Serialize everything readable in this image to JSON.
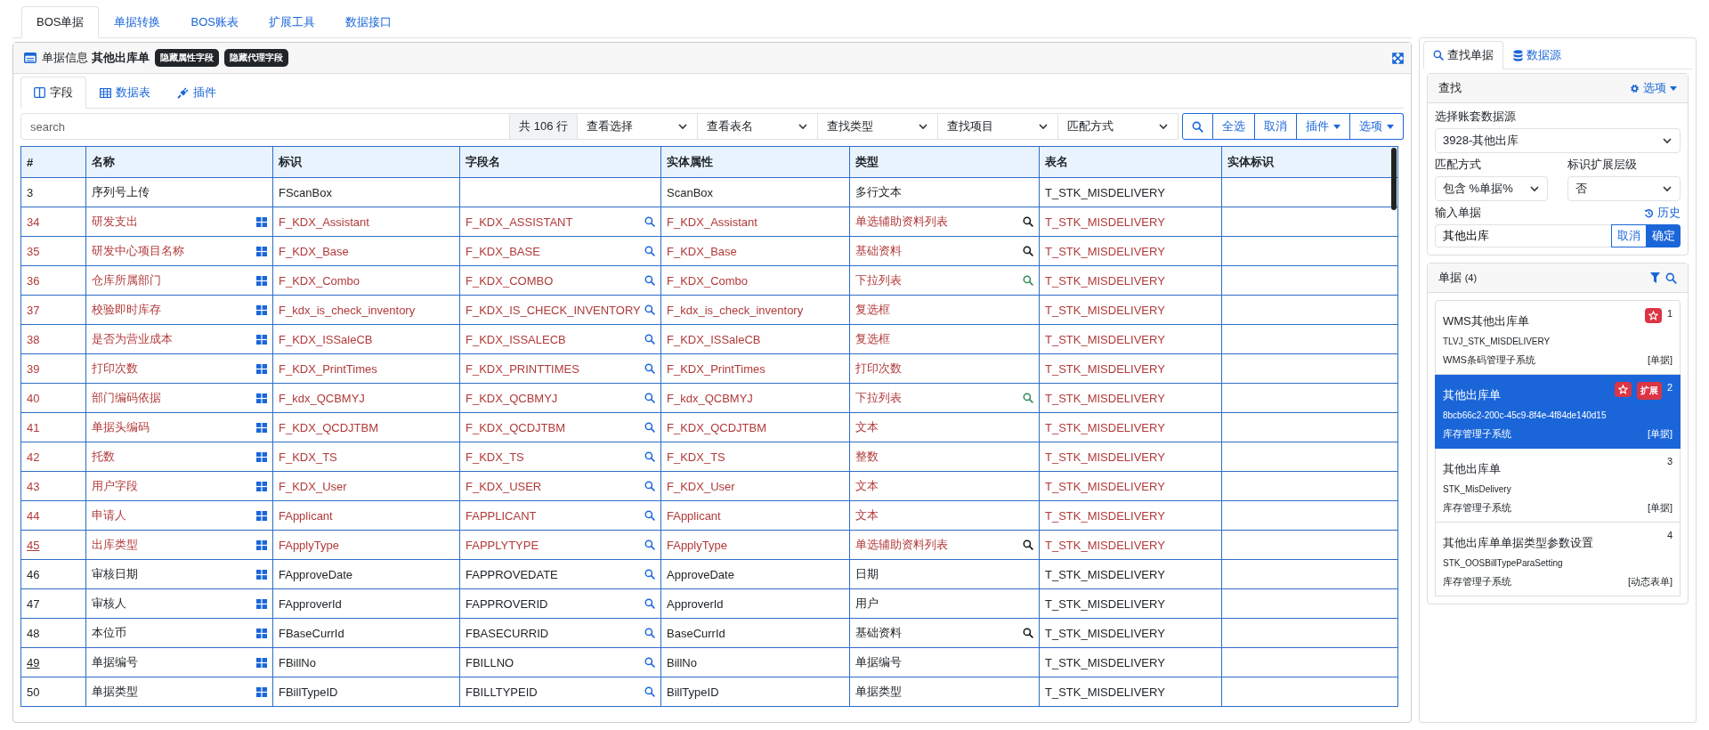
{
  "top_tabs": [
    {
      "label": "BOS单据",
      "selected": true
    },
    {
      "label": "单据转换",
      "selected": false
    },
    {
      "label": "BOS账表",
      "selected": false
    },
    {
      "label": "扩展工具",
      "selected": false
    },
    {
      "label": "数据接口",
      "selected": false
    }
  ],
  "panel": {
    "label": "单据信息",
    "bill": "其他出库单",
    "badges": [
      "隐藏属性字段",
      "隐藏代理字段"
    ]
  },
  "inner_tabs": [
    {
      "label": "字段",
      "selected": true
    },
    {
      "label": "数据表",
      "selected": false
    },
    {
      "label": "插件",
      "selected": false
    }
  ],
  "toolbar": {
    "search_placeholder": "search",
    "count": "共 106 行",
    "selects": [
      "查看选择",
      "查看表名",
      "查找类型",
      "查找项目",
      "匹配方式"
    ],
    "buttons": [
      {
        "kind": "search"
      },
      {
        "kind": "text",
        "label": "全选"
      },
      {
        "kind": "text",
        "label": "取消"
      },
      {
        "kind": "menu",
        "label": "插件"
      },
      {
        "kind": "menu",
        "label": "选项"
      }
    ]
  },
  "table": {
    "columns": [
      "#",
      "名称",
      "标识",
      "字段名",
      "实体属性",
      "类型",
      "表名",
      "实体标识"
    ],
    "rows": [
      {
        "num": "3",
        "name": "序列号上传",
        "key": "FScanBox",
        "field": "",
        "entity": "ScanBox",
        "type": "多行文本",
        "table": "T_STK_MISDELIVERY",
        "extension": false,
        "underlined": false,
        "name_icon": false,
        "field_icon": false
      },
      {
        "num": "34",
        "name": "研发支出",
        "key": "F_KDX_Assistant",
        "field": "F_KDX_ASSISTANT",
        "entity": "F_KDX_Assistant",
        "type": "单选辅助资料列表",
        "table": "T_STK_MISDELIVERY",
        "extension": true,
        "underlined": false,
        "name_icon": true,
        "field_icon": true,
        "color": "#111111"
      },
      {
        "num": "35",
        "name": "研发中心项目名称",
        "key": "F_KDX_Base",
        "field": "F_KDX_BASE",
        "entity": "F_KDX_Base",
        "type": "基础资料",
        "table": "T_STK_MISDELIVERY",
        "extension": true,
        "underlined": false,
        "name_icon": true,
        "field_icon": true,
        "color": "#111111"
      },
      {
        "num": "36",
        "name": "仓库所属部门",
        "key": "F_KDX_Combo",
        "field": "F_KDX_COMBO",
        "entity": "F_KDX_Combo",
        "type": "下拉列表",
        "table": "T_STK_MISDELIVERY",
        "extension": true,
        "underlined": false,
        "name_icon": true,
        "field_icon": true,
        "color": "#2e8b57"
      },
      {
        "num": "37",
        "name": "校验即时库存",
        "key": "F_kdx_is_check_inventory",
        "field": "F_KDX_IS_CHECK_INVENTORY",
        "entity": "F_kdx_is_check_inventory",
        "type": "复选框",
        "table": "T_STK_MISDELIVERY",
        "extension": true,
        "underlined": false,
        "name_icon": true,
        "field_icon": true
      },
      {
        "num": "38",
        "name": "是否为营业成本",
        "key": "F_KDX_ISSaleCB",
        "field": "F_KDX_ISSALECB",
        "entity": "F_KDX_ISSaleCB",
        "type": "复选框",
        "table": "T_STK_MISDELIVERY",
        "extension": true,
        "underlined": false,
        "name_icon": true,
        "field_icon": true
      },
      {
        "num": "39",
        "name": "打印次数",
        "key": "F_KDX_PrintTimes",
        "field": "F_KDX_PRINTTIMES",
        "entity": "F_KDX_PrintTimes",
        "type": "打印次数",
        "table": "T_STK_MISDELIVERY",
        "extension": true,
        "underlined": false,
        "name_icon": true,
        "field_icon": true
      },
      {
        "num": "40",
        "name": "部门编码依据",
        "key": "F_kdx_QCBMYJ",
        "field": "F_KDX_QCBMYJ",
        "entity": "F_kdx_QCBMYJ",
        "type": "下拉列表",
        "table": "T_STK_MISDELIVERY",
        "extension": true,
        "underlined": false,
        "name_icon": true,
        "field_icon": true,
        "color": "#2e8b57"
      },
      {
        "num": "41",
        "name": "单据头编码",
        "key": "F_KDX_QCDJTBM",
        "field": "F_KDX_QCDJTBM",
        "entity": "F_KDX_QCDJTBM",
        "type": "文本",
        "table": "T_STK_MISDELIVERY",
        "extension": true,
        "underlined": false,
        "name_icon": true,
        "field_icon": true
      },
      {
        "num": "42",
        "name": "托数",
        "key": "F_KDX_TS",
        "field": "F_KDX_TS",
        "entity": "F_KDX_TS",
        "type": "整数",
        "table": "T_STK_MISDELIVERY",
        "extension": true,
        "underlined": false,
        "name_icon": true,
        "field_icon": true
      },
      {
        "num": "43",
        "name": "用户字段",
        "key": "F_KDX_User",
        "field": "F_KDX_USER",
        "entity": "F_KDX_User",
        "type": "文本",
        "table": "T_STK_MISDELIVERY",
        "extension": true,
        "underlined": false,
        "name_icon": true,
        "field_icon": true
      },
      {
        "num": "44",
        "name": "申请人",
        "key": "FApplicant",
        "field": "FAPPLICANT",
        "entity": "FApplicant",
        "type": "文本",
        "table": "T_STK_MISDELIVERY",
        "extension": true,
        "underlined": false,
        "name_icon": true,
        "field_icon": true
      },
      {
        "num": "45",
        "name": "出库类型",
        "key": "FApplyType",
        "field": "FAPPLYTYPE",
        "entity": "FApplyType",
        "type": "单选辅助资料列表",
        "table": "T_STK_MISDELIVERY",
        "extension": true,
        "underlined": true,
        "name_icon": true,
        "field_icon": true,
        "color": "#111111"
      },
      {
        "num": "46",
        "name": "审核日期",
        "key": "FApproveDate",
        "field": "FAPPROVEDATE",
        "entity": "ApproveDate",
        "type": "日期",
        "table": "T_STK_MISDELIVERY",
        "extension": false,
        "underlined": false,
        "name_icon": true,
        "field_icon": true
      },
      {
        "num": "47",
        "name": "审核人",
        "key": "FApproverId",
        "field": "FAPPROVERID",
        "entity": "ApproverId",
        "type": "用户",
        "table": "T_STK_MISDELIVERY",
        "extension": false,
        "underlined": false,
        "name_icon": true,
        "field_icon": true
      },
      {
        "num": "48",
        "name": "本位币",
        "key": "FBaseCurrId",
        "field": "FBASECURRID",
        "entity": "BaseCurrId",
        "type": "基础资料",
        "table": "T_STK_MISDELIVERY",
        "extension": false,
        "underlined": false,
        "name_icon": true,
        "field_icon": true,
        "color": "#111111"
      },
      {
        "num": "49",
        "name": "单据编号",
        "key": "FBillNo",
        "field": "FBILLNO",
        "entity": "BillNo",
        "type": "单据编号",
        "table": "T_STK_MISDELIVERY",
        "extension": false,
        "underlined": true,
        "name_icon": true,
        "field_icon": true
      },
      {
        "num": "50",
        "name": "单据类型",
        "key": "FBillTypeID",
        "field": "FBILLTYPEID",
        "entity": "BillTypeID",
        "type": "单据类型",
        "table": "T_STK_MISDELIVERY",
        "extension": false,
        "underlined": false,
        "name_icon": true,
        "field_icon": true
      }
    ]
  },
  "side_tabs": [
    {
      "label": "查找单据",
      "selected": true
    },
    {
      "label": "数据源",
      "selected": false
    }
  ],
  "find": {
    "title": "查找",
    "options": "选项",
    "source_label": "选择账套数据源",
    "source": "3928-其他出库",
    "match_label": "匹配方式",
    "match": "包含 %单据%",
    "level_label": "标识扩展层级",
    "level": "否",
    "input_label": "输入单据",
    "history": "历史",
    "input_value": "其他出库",
    "cancel": "取消",
    "ok": "确定"
  },
  "bills": {
    "title": "单据",
    "count": "(4)",
    "items": [
      {
        "index": "1",
        "title": "WMS其他出库单",
        "id": "TLVJ_STK_MISDELIVERY",
        "subsystem": "WMS条码管理子系统",
        "kind": "[单据]",
        "starred": true,
        "selected": false
      },
      {
        "index": "2",
        "title": "其他出库单",
        "id": "8bcb66c2-200c-45c9-8f4e-4f84de140d15",
        "subsystem": "库存管理子系统",
        "kind": "[单据]",
        "starred": true,
        "extension_badge": "扩展",
        "selected": true
      },
      {
        "index": "3",
        "title": "其他出库单",
        "id": "STK_MisDelivery",
        "subsystem": "库存管理子系统",
        "kind": "[单据]",
        "starred": false,
        "selected": false
      },
      {
        "index": "4",
        "title": "其他出库单单据类型参数设置",
        "id": "STK_OOSBillTypeParaSetting",
        "subsystem": "库存管理子系统",
        "kind": "[动态表单]",
        "starred": false,
        "selected": false
      }
    ]
  }
}
